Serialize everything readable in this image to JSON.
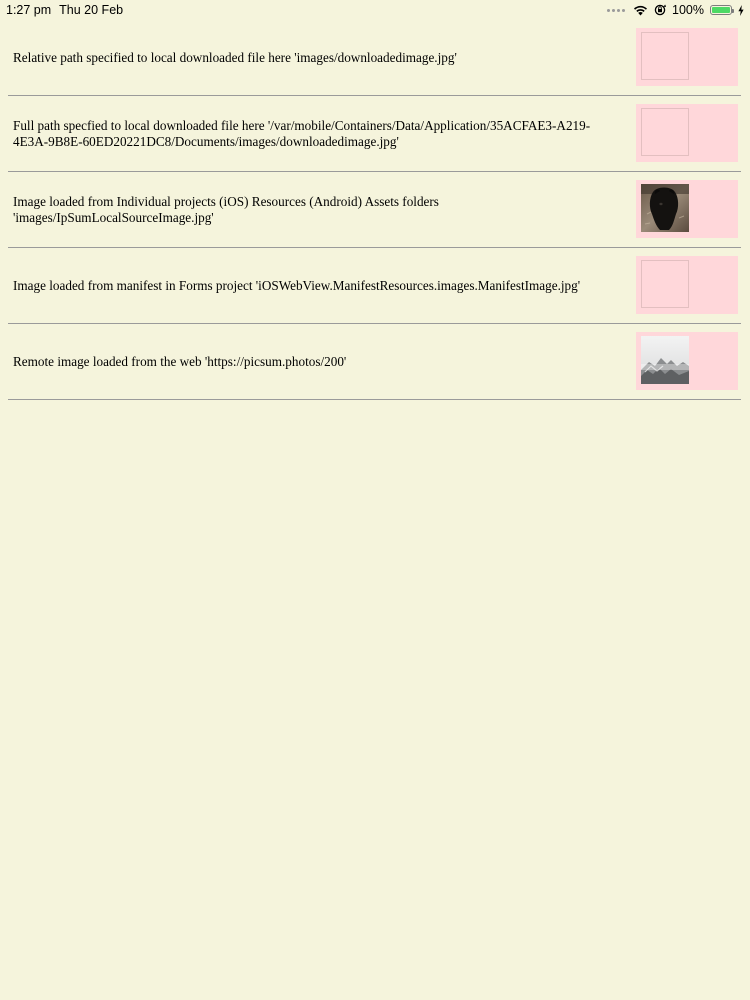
{
  "status_bar": {
    "time": "1:27 pm",
    "date": "Thu 20 Feb",
    "battery_percent": "100%",
    "battery_level": 1.0,
    "icons": [
      "signal-dots-icon",
      "wifi-icon",
      "orientation-lock-icon",
      "battery-icon",
      "charging-bolt-icon"
    ],
    "battery_color": "#4cd964"
  },
  "page": {
    "background": "#f5f4dc",
    "image_box_background": "#ffd7da"
  },
  "rows": [
    {
      "text": "Relative path specified to local downloaded file here 'images/downloadedimage.jpg'",
      "image": "empty"
    },
    {
      "text": "Full path specfied to local downloaded file here '/var/mobile/Containers/Data/Application/35ACFAE3-A219-4E3A-9B8E-60ED20221DC8/Documents/images/downloadedimage.jpg'",
      "image": "empty"
    },
    {
      "text": "Image loaded from Individual projects (iOS) Resources (Android) Assets folders 'images/IpSumLocalSourceImage.jpg'",
      "image": "dark-animal-photo"
    },
    {
      "text": "Image loaded from manifest in Forms project 'iOSWebView.ManifestResources.images.ManifestImage.jpg'",
      "image": "empty"
    },
    {
      "text": "Remote image loaded from the web 'https://picsum.photos/200'",
      "image": "misty-mountain-photo"
    }
  ]
}
